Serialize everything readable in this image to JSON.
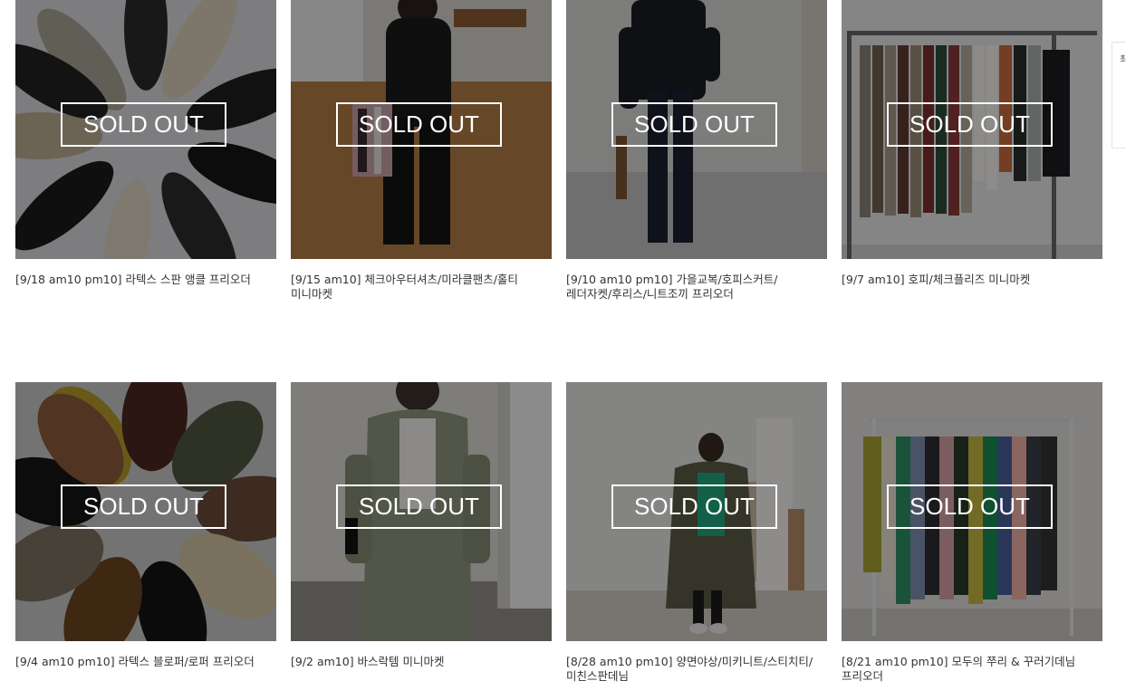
{
  "sold_out_label": "SOLD OUT",
  "products": [
    {
      "caption": "[9/18 am10 pm10] 라텍스 스판 앵클 프리오더",
      "image": "boots-circle"
    },
    {
      "caption": "[9/15 am10] 체크아우터셔츠/미라클팬츠/홀티 미니마켓",
      "image": "black-outfit-shirt"
    },
    {
      "caption": "[9/10 am10 pm10] 가을교복/호피스커트/레더자켓/후리스/니트조끼 프리오더",
      "image": "black-fleece"
    },
    {
      "caption": "[9/7 am10] 호피/체크플리즈 미니마켓",
      "image": "skirt-rack"
    },
    {
      "caption": "[9/4 am10 pm10] 라텍스 블로퍼/로퍼 프리오더",
      "image": "loafers-circle"
    },
    {
      "caption": "[9/2 am10] 바스락템 미니마켓",
      "image": "khaki-jacket"
    },
    {
      "caption": "[8/28 am10 pm10] 양면야상/미키니트/스티치티/미친스판데님",
      "image": "parka-studio"
    },
    {
      "caption": "[8/21 am10 pm10] 모두의 쭈리 & 꾸러기데님 프리오더",
      "image": "sweatshirt-rack"
    }
  ],
  "side_tab_glyph": "최"
}
